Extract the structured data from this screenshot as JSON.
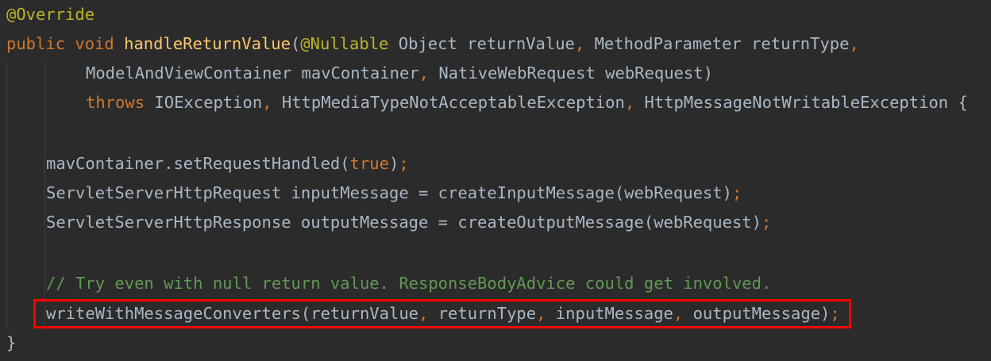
{
  "colors": {
    "background": "#2b2b2b",
    "keyword": "#cc7832",
    "annotation": "#bbb529",
    "method_declaration": "#ffc66d",
    "comment": "#629755",
    "plain": "#a9b7c6",
    "highlight_box": "#ff0000"
  },
  "code": {
    "l1": {
      "annotation": "@Override"
    },
    "l2": {
      "kw_public": "public",
      "kw_void": "void",
      "method_name": "handleReturnValue",
      "paren_open": "(",
      "annotation": "@Nullable",
      "params": "Object returnValue",
      "comma": ",",
      "params2": "MethodParameter returnType",
      "comma2": ","
    },
    "l3": {
      "p1": "ModelAndViewContainer mavContainer",
      "comma": ",",
      "p2": "NativeWebRequest webRequest)"
    },
    "l4": {
      "kw_throws": "throws",
      "e1": "IOException",
      "comma1": ",",
      "e2": "HttpMediaTypeNotAcceptableException",
      "comma2": ",",
      "e3": "HttpMessageNotWritableException {"
    },
    "l6": {
      "call": "mavContainer.setRequestHandled(",
      "kw_true": "true",
      "close": ")",
      "semi": ";"
    },
    "l7": {
      "text": "ServletServerHttpRequest inputMessage = createInputMessage(webRequest)",
      "semi": ";"
    },
    "l8": {
      "text": "ServletServerHttpResponse outputMessage = createOutputMessage(webRequest)",
      "semi": ";"
    },
    "l10": {
      "comment": "// Try even with null return value. ResponseBodyAdvice could get involved."
    },
    "l11": {
      "c1": "writeWithMessageConverters(returnValue",
      "comma1": ",",
      "c2": "returnType",
      "comma2": ",",
      "c3": "inputMessage",
      "comma3": ",",
      "c4": "outputMessage)",
      "semi": ";"
    },
    "l12": {
      "brace": "}"
    }
  }
}
